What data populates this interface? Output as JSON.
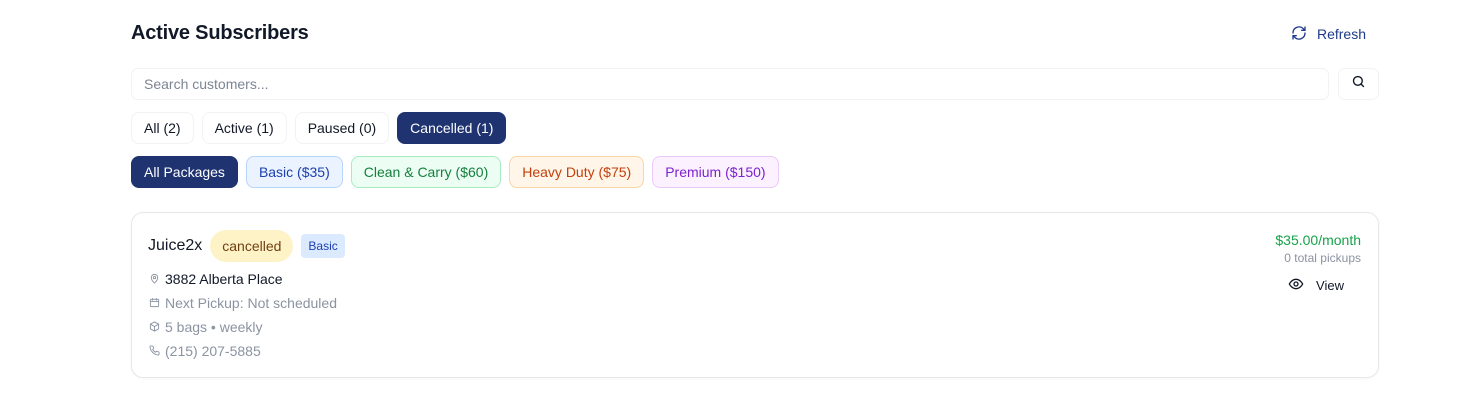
{
  "header": {
    "title": "Active Subscribers",
    "refresh_label": "Refresh"
  },
  "search": {
    "placeholder": "Search customers...",
    "value": ""
  },
  "status_filters": [
    {
      "label": "All (2)",
      "selected": false
    },
    {
      "label": "Active (1)",
      "selected": false
    },
    {
      "label": "Paused (0)",
      "selected": false
    },
    {
      "label": "Cancelled (1)",
      "selected": true
    }
  ],
  "package_filters": [
    {
      "label": "All Packages",
      "selected": true
    },
    {
      "label": "Basic ($35)",
      "selected": false
    },
    {
      "label": "Clean & Carry ($60)",
      "selected": false
    },
    {
      "label": "Heavy Duty ($75)",
      "selected": false
    },
    {
      "label": "Premium ($150)",
      "selected": false
    }
  ],
  "subscriber": {
    "name": "Juice2x",
    "status": "cancelled",
    "package": "Basic",
    "address": "3882 Alberta Place",
    "next_pickup": "Next Pickup: Not scheduled",
    "bags": "5 bags • weekly",
    "phone": "(215) 207-5885",
    "price": "$35.00/month",
    "pickups": "0 total pickups",
    "view_label": "View"
  },
  "colors": {
    "primary": "#1e3370",
    "price_green": "#16a34a",
    "status_badge_bg": "#fef3c7",
    "basic_badge_bg": "#dbeafe"
  },
  "icons": [
    "refresh-icon",
    "search-icon",
    "map-pin-icon",
    "calendar-icon",
    "package-icon",
    "phone-icon",
    "eye-icon"
  ]
}
